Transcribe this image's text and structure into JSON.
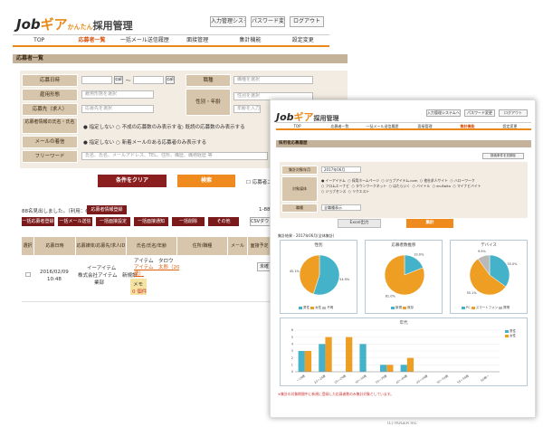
{
  "back": {
    "logo": {
      "main": "Job",
      "accent": "ギア",
      "mid": "かんたん",
      "sub": "採用管理"
    },
    "top_buttons": [
      "入力管理システムへ",
      "パスワード変更",
      "ログアウト"
    ],
    "nav": [
      "TOP",
      "応募者一覧",
      "一括メール送信履歴",
      "面接管理",
      "集計機能",
      "設定変更"
    ],
    "section_title": "応募者一覧",
    "form": {
      "labels": [
        "応募日時",
        "雇用形態",
        "応募先（求人）",
        "応募者情報の氏名・氏名",
        "メールの着信",
        "フリーワード",
        "職種",
        "性別・年齢"
      ],
      "date_btn": "cal",
      "date_sep": "〜",
      "placeholder_employment": "雇用形態を選択",
      "placeholder_job": "応募先を選択",
      "placeholder_shokushu": "職種を選択",
      "placeholder_gender": "性別を選択",
      "placeholder_age": "年齢を入力",
      "placeholder_free": "氏名、氏名、メールアドレス、TEL、住所、職歴、職務経歴 等",
      "radio_name": [
        "指定しない",
        "不成の応募数のみ表示する",
        "既読の応募数のみ表示する"
      ],
      "radio_mail": [
        "指定しない",
        "新着メールのある応募者のみ表示する"
      ],
      "clear_btn": "条件をクリア",
      "search_btn": "検索",
      "check_label": "応募者ユーザ"
    },
    "result_text": "88名見出しました。（利用：6名）",
    "result_badge": "応募者情報登録",
    "page_info": "1-88",
    "toolbar": [
      "一括応募者登録",
      "一括メール送信",
      "一括面接設定",
      "一括面接通知",
      "一括削除",
      "その他"
    ],
    "csv_btn": "CSVダウン",
    "table": {
      "headers": [
        "選択",
        "応募日時",
        "応募媒体/応募先/求人ID",
        "氏名/氏名/年齢",
        "住所/職種",
        "メール",
        "面接予定"
      ],
      "row": {
        "date": "2016/02/09",
        "time": "10:48",
        "media1": "イーアイテム",
        "media2": "株式会社アイテム　新規設",
        "media3": "業部",
        "name_kana": "アイテム　タロウ",
        "name": "アイテム　太郎（20",
        "name2": "歳）",
        "memo": "メモ",
        "memo_count": "0 個件",
        "action": "未確"
      }
    }
  },
  "front": {
    "logo": {
      "main": "Job",
      "accent": "ギア",
      "sub": "採用管理"
    },
    "top_buttons": [
      "入力管理システムへ",
      "パスワード変更",
      "ログアウト"
    ],
    "nav": [
      "TOP",
      "応募者一覧",
      "一括メール送信履歴",
      "面接管理",
      "集計機能",
      "設定変更"
    ],
    "section_title": "採用者応募履歴",
    "reset_btn": "検索条件を初期化",
    "labels": [
      "集計対象年月",
      "対象媒体",
      "職種"
    ],
    "period_value": "2017年06月",
    "media_options": [
      "イーアイテム",
      "採用ホームページ",
      "ジョブアイテム.com",
      "他社求人サイト",
      "ハローワーク",
      "フロムエーナビ",
      "タウンワークネット",
      "はたらいく",
      "バイトル",
      "en-Baito",
      "マイナビバイト",
      "ジョブセンス",
      "リクエスト"
    ],
    "job_value": "全職種表示",
    "excel_btn": "Excel出力",
    "aggregate_btn": "集計",
    "result_header": "集計結果 - 2017年06月(全体集計)",
    "footer_note": "※集計の対象期間中に新規に登録した応募者数のみ集計対象としています。",
    "copyright": "(C) RUGER Inc.",
    "colors": {
      "blue": "#44b3c9",
      "orange": "#ef9e24",
      "gray": "#b9b9b9"
    }
  },
  "chart_data": [
    {
      "type": "pie",
      "title": "性別",
      "labels": [
        "男性",
        "女性",
        "不明"
      ],
      "values": [
        54.9,
        45.1,
        0
      ],
      "data_labels": [
        "54.9%",
        "45.1%"
      ],
      "legend": "bottom"
    },
    {
      "type": "pie",
      "title": "応募者数推移",
      "labels": [
        "新規",
        "既存"
      ],
      "values": [
        19.0,
        81.0
      ],
      "data_labels": [
        "19.0%",
        "81.0%"
      ],
      "legend": "bottom"
    },
    {
      "type": "pie",
      "title": "デバイス",
      "labels": [
        "PC",
        "スマートフォン",
        "携帯"
      ],
      "values": [
        35.0,
        55.1,
        9.9
      ],
      "data_labels": [
        "35.0%",
        "55.1%",
        "9.9%"
      ],
      "legend": "bottom"
    },
    {
      "type": "bar",
      "title": "年代",
      "categories": [
        "〜19歳",
        "20〜24歳",
        "25〜29歳",
        "30〜34歳",
        "35〜39歳",
        "40〜44歳",
        "45〜49歳",
        "50〜54歳",
        "55〜59歳",
        "60歳〜"
      ],
      "series": [
        {
          "name": "男性",
          "values": [
            3,
            4,
            0,
            4,
            1,
            1,
            0,
            0,
            0,
            0
          ]
        },
        {
          "name": "女性",
          "values": [
            3,
            5,
            5,
            0,
            1,
            2,
            0,
            0,
            0,
            0
          ]
        }
      ],
      "ylim": [
        0,
        6
      ],
      "legend": "top-right",
      "grid": true
    }
  ]
}
